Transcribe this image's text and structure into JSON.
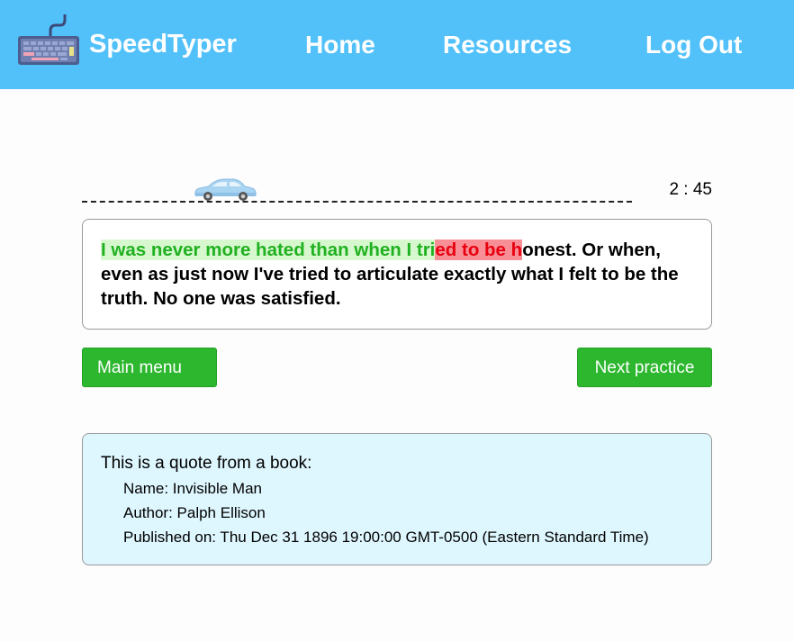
{
  "header": {
    "brand": "SpeedTyper",
    "nav": {
      "home": "Home",
      "resources": "Resources",
      "logout": "Log Out"
    },
    "logo_icon": "keyboard-icon",
    "color": "#52c1f9"
  },
  "race": {
    "timer": "2 : 45",
    "car_icon": "car-icon",
    "progress_fraction": 0.21
  },
  "passage": {
    "correct": "I was never more hated than when I tri",
    "wrong": "ed to be h",
    "remaining": "onest. Or when, even as just now I've tried to articulate exactly what I felt to be the truth. No one was satisfied.",
    "correct_color": "#20b120",
    "wrong_color": "#e8000f"
  },
  "buttons": {
    "main_menu": "Main menu",
    "next_practice": "Next practice",
    "color": "#2cb72e"
  },
  "info": {
    "intro": "This is a quote from a book:",
    "name": "Name: Invisible Man",
    "author": "Author: Palph Ellison",
    "published": "Published on: Thu Dec 31 1896 19:00:00 GMT-0500 (Eastern Standard Time)"
  }
}
